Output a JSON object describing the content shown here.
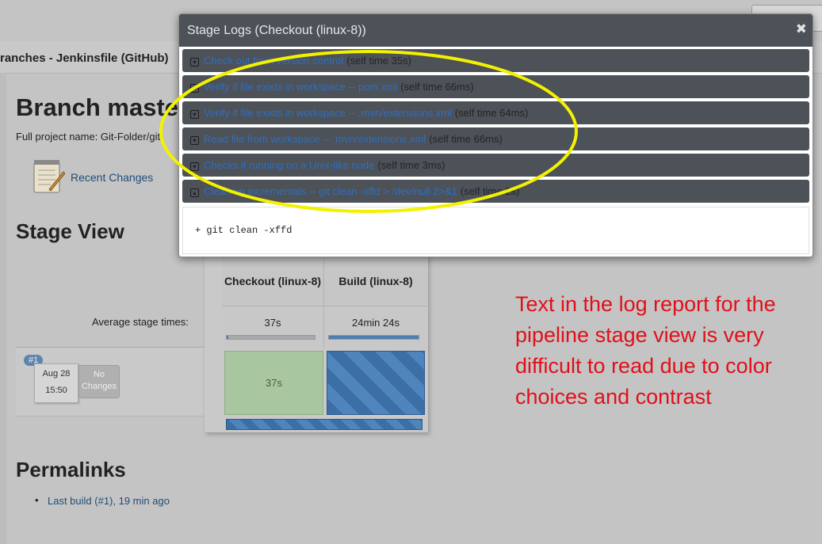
{
  "page": {
    "breadcrumb": "ranches - Jenkinsfile (GitHub)",
    "title": "Branch maste",
    "project_name": "Full project name: Git-Folder/git-",
    "recent_changes": "Recent Changes",
    "stage_view_title": "Stage View",
    "average_label": "Average stage times:",
    "permalinks_title": "Permalinks",
    "permalinks": [
      "Last build (#1), 19 min ago"
    ]
  },
  "stage_view": {
    "columns": [
      {
        "name": "Checkout (linux-8)",
        "avg_time": "37s",
        "avg_progress": 0.02
      },
      {
        "name": "Build (linux-8)",
        "avg_time": "24min 24s",
        "avg_progress": 1.0
      }
    ],
    "build": {
      "badge": "#1",
      "date": "Aug 28",
      "time": "15:50",
      "changes": "No Changes",
      "cells": [
        {
          "status": "success",
          "text": "37s"
        },
        {
          "status": "running",
          "text": ""
        }
      ]
    }
  },
  "modal": {
    "title": "Stage Logs (Checkout (linux-8))",
    "close_icon": "close-icon",
    "rows": [
      {
        "name": "Check out from version control",
        "time": "(self time 35s)",
        "expanded": false
      },
      {
        "name": "Verify if file exists in workspace -- pom.xml",
        "time": "(self time 66ms)",
        "expanded": false
      },
      {
        "name": "Verify if file exists in workspace -- .mvn/extensions.xml",
        "time": "(self time 64ms)",
        "expanded": false
      },
      {
        "name": "Read file from workspace -- .mvn/extensions.xml",
        "time": "(self time 66ms)",
        "expanded": false
      },
      {
        "name": "Checks if running on a Unix-like node",
        "time": "(self time 3ms)",
        "expanded": false
      },
      {
        "name": "Clean up incrementals -- git clean -xffd > /dev/null 2>&1",
        "time": "(self time 2s)",
        "expanded": true
      }
    ],
    "log_output": "+ git clean -xffd"
  },
  "annotation": {
    "text": "Text in the log report for the pipeline stage view is very difficult to read due to color choices and contrast",
    "color": "#e0101a",
    "ellipse_color": "#f2f200"
  },
  "colors": {
    "modal_header": "#4d5158",
    "link_blue": "#2b70c4",
    "success_green": "#a8c7a0",
    "running_blue": "#3b6fa6"
  }
}
